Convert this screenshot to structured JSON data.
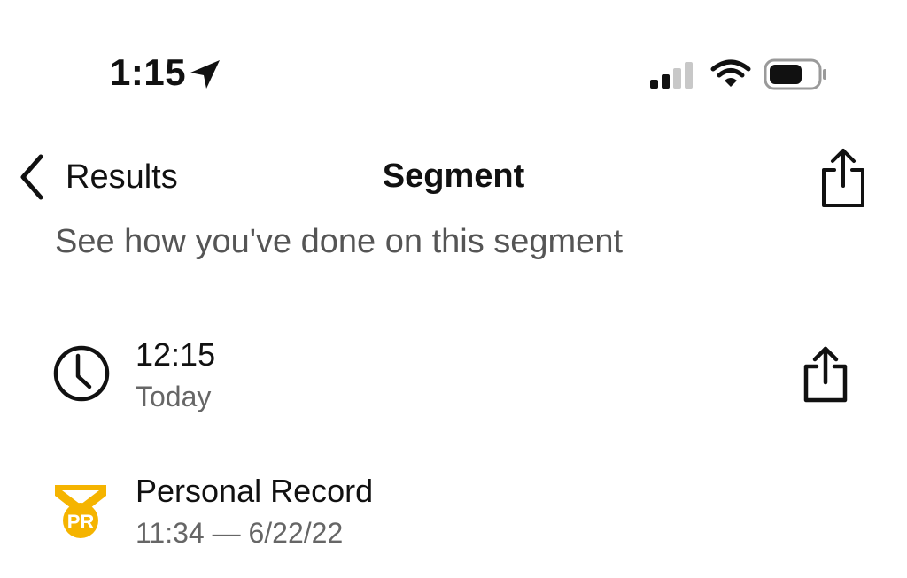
{
  "status_bar": {
    "time": "1:15",
    "location_icon": "location-arrow-icon",
    "signal_icon": "cellular-signal-icon",
    "wifi_icon": "wifi-icon",
    "battery_icon": "battery-icon"
  },
  "nav": {
    "back_label": "Results",
    "title": "Segment",
    "back_icon": "chevron-left-icon",
    "share_icon": "share-icon"
  },
  "subtitle": "See how you've done on this segment",
  "efforts": [
    {
      "icon": "clock-icon",
      "primary": "12:15",
      "secondary": "Today",
      "share_icon": "share-icon"
    },
    {
      "icon": "pr-medal-icon",
      "icon_text": "PR",
      "primary": "Personal Record",
      "secondary": "11:34 — 6/22/22",
      "accent_color": "#F5B400"
    }
  ]
}
